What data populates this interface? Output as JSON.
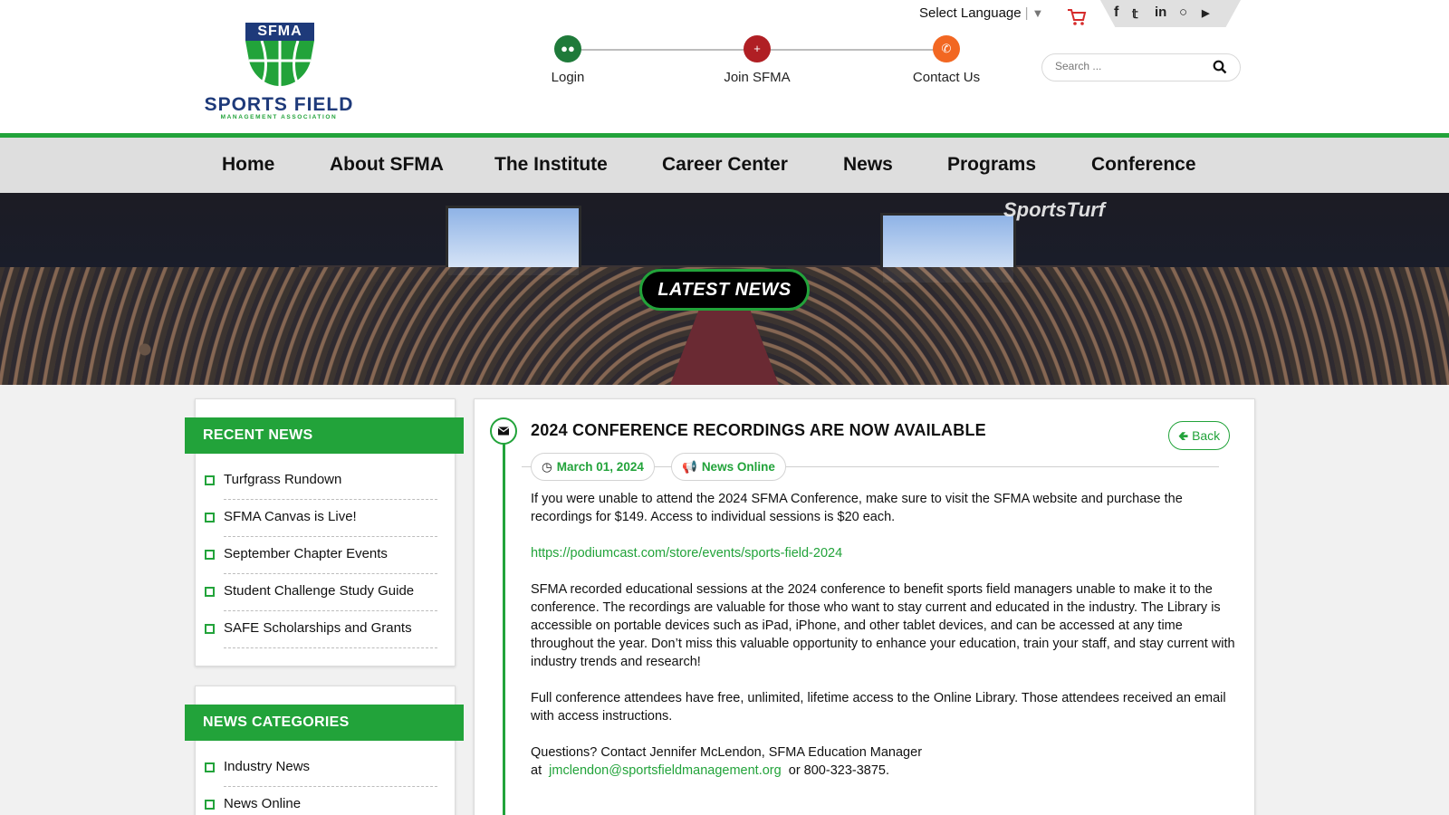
{
  "colors": {
    "brand_green": "#22a33a",
    "brand_navy": "#1e3a7a",
    "nav_bg": "#dedede"
  },
  "header": {
    "logo": {
      "abbr": "SFMA",
      "name": "SPORTS FIELD",
      "subtitle": "MANAGEMENT ASSOCIATION"
    },
    "steps": [
      {
        "label": "Login",
        "icon": "users-icon",
        "color": "#1f7a3a"
      },
      {
        "label": "Join SFMA",
        "icon": "add-user-icon",
        "color": "#b01f24"
      },
      {
        "label": "Contact Us",
        "icon": "phone-icon",
        "color": "#f26722"
      }
    ],
    "language": {
      "label": "Select Language",
      "arrow": "▼"
    },
    "social": [
      "facebook-icon",
      "twitter-icon",
      "linkedin-icon",
      "instagram-icon",
      "youtube-icon"
    ],
    "search": {
      "placeholder": "Search ..."
    }
  },
  "nav": {
    "items": [
      "Home",
      "About SFMA",
      "The Institute",
      "Career Center",
      "News",
      "Programs",
      "Conference"
    ]
  },
  "banner": {
    "badge": "LATEST NEWS",
    "brand": "SportsTurf"
  },
  "sidebar": {
    "recent": {
      "title": "RECENT NEWS",
      "items": [
        "Turfgrass Rundown",
        "SFMA Canvas is Live!",
        "September Chapter Events",
        "Student Challenge Study Guide",
        "SAFE Scholarships and Grants"
      ]
    },
    "categories": {
      "title": "NEWS CATEGORIES",
      "items": [
        "Industry News",
        "News Online"
      ]
    }
  },
  "article": {
    "title": "2024 CONFERENCE RECORDINGS ARE NOW AVAILABLE",
    "back_label": "Back",
    "date": "March 01, 2024",
    "category": "News Online",
    "p1": "If you were unable to attend the 2024 SFMA Conference, make sure to visit the SFMA website and purchase the recordings for $149. Access to individual sessions is $20 each.",
    "link": "https://podiumcast.com/store/events/sports-field-2024",
    "p2": "SFMA recorded educational sessions at the 2024 conference to benefit sports field managers unable to make it to the conference. The recordings are valuable for those who want to stay current and educated in the industry. The Library is accessible on portable devices such as iPad, iPhone, and other tablet devices, and can be accessed at any time throughout the year. Don’t miss this valuable opportunity to enhance your education, train your staff, and stay current with industry trends and research!",
    "p3": "Full conference attendees have free, unlimited, lifetime access to the Online Library. Those attendees received an email with access instructions.",
    "p4_line1": "Questions? Contact Jennifer McLendon, SFMA Education Manager",
    "p4_at": "at",
    "p4_email": "jmclendon@sportsfieldmanagement.org",
    "p4_phone": "or 800-323-3875."
  }
}
